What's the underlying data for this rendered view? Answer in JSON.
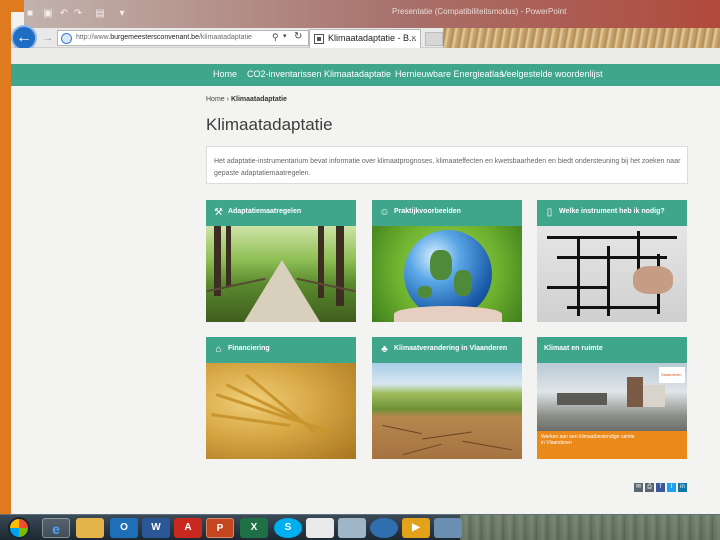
{
  "browser": {
    "url_prefix": "http://www.",
    "url_domain": "burgemeestersconvenant.be",
    "url_path": "/klimaatadaptatie",
    "tab_title": "Klimaatadaptatie - B...",
    "tab_close": "×",
    "back_glyph": "←",
    "forward_glyph": "→",
    "search_glyph": "⚲",
    "dropdown_glyph": "▾",
    "refresh_glyph": "↻",
    "background_title": "Presentatie (Compatibiliteitsmodus) - PowerPoint"
  },
  "nav": {
    "items": [
      "Home",
      "CO2-inventarissen",
      "Klimaatadaptatie",
      "Hernieuwbare Energieatlas",
      "Veelgestelde woordenlijst"
    ]
  },
  "breadcrumb": {
    "home": "Home",
    "separator": "›",
    "current": "Klimaatadaptatie"
  },
  "page_title": "Klimaatadaptatie",
  "intro": "Het adaptatie-instrumentarium bevat informatie over klimaatprognoses, klimaateffecten en kwetsbaarheden en biedt ondersteuning bij het zoeken naar gepaste adaptatiemaatregelen.",
  "cards": [
    {
      "label": "Adaptatiemaatregelen",
      "icon": "tools-icon"
    },
    {
      "label": "Praktijkvoorbeelden",
      "icon": "people-icon"
    },
    {
      "label": "Welke instrument heb ik nodig?",
      "icon": "book-icon"
    },
    {
      "label": "Financiering",
      "icon": "bank-icon"
    },
    {
      "label": "Klimaatverandering in Vlaanderen",
      "icon": "tree-icon"
    },
    {
      "label": "Klimaat en ruimte",
      "icon": ""
    }
  ],
  "ruimte_banner": "Werken aan een klimaatbestendige ruimte in Vlaanderen",
  "ruimte_logo": "Vlaanderen",
  "share": [
    "mail",
    "print",
    "facebook",
    "twitter",
    "linkedin"
  ],
  "share_glyphs": [
    "✉",
    "⎙",
    "f",
    "t",
    "in"
  ],
  "taskbar": {
    "items": [
      "ie-icon",
      "folder-icon",
      "outlook-icon",
      "word-icon",
      "acrobat-icon",
      "powerpoint-icon",
      "excel-icon",
      "skype-icon",
      "app-icon",
      "calculator-icon",
      "earth-icon",
      "media-icon",
      "paint-icon"
    ],
    "glyphs": [
      "e",
      "",
      "O",
      "W",
      "A",
      "P",
      "X",
      "S",
      "",
      "",
      "",
      "▶",
      ""
    ]
  },
  "colors": {
    "accent": "#3fa68c",
    "slide_orange": "#e07a1f",
    "taskbar": "#1c2832"
  }
}
